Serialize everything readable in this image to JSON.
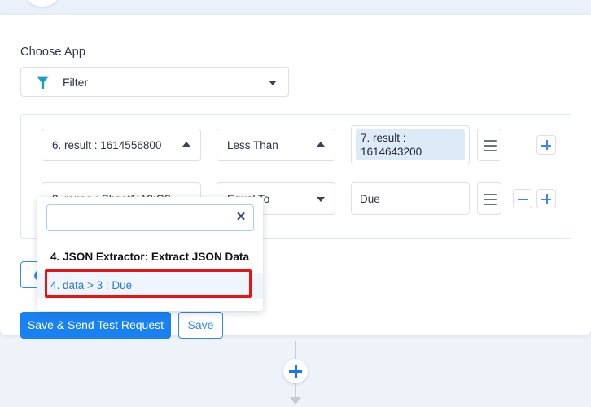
{
  "choose_app": {
    "label": "Choose App",
    "selected": "Filter",
    "icon": "funnel-icon",
    "caret": "chevron-down-icon"
  },
  "filter_rows": [
    {
      "field": "6. result : 1614556800",
      "field_caret": "chevron-up-icon",
      "operator": "Less Than",
      "operator_caret": "chevron-up-icon",
      "value": "7. result : 1614643200",
      "value_is_chip": true,
      "menu_icon": "hamburger-icon",
      "add_label": "+",
      "has_remove": false
    },
    {
      "field": "2. range : Sheet1!A2:G3",
      "field_caret": "chevron-down-icon",
      "operator": "Equal To",
      "operator_caret": "chevron-down-icon",
      "value": "Due",
      "value_is_chip": false,
      "menu_icon": "hamburger-icon",
      "add_label": "+",
      "remove_label": "−",
      "has_remove": true
    }
  ],
  "dropdown": {
    "search_value": "",
    "search_placeholder": "",
    "clear_icon": "✕",
    "group_label": "4. JSON Extractor: Extract JSON Data",
    "items": [
      {
        "label": "4. data > 3 : Due",
        "highlighted": true
      }
    ],
    "highlight_color": "#e81414"
  },
  "actions": {
    "reload_icon": "refresh-icon",
    "primary_label": "Save & Send Test Request",
    "secondary_label": "Save"
  },
  "flow": {
    "add_step_icon": "plus-icon"
  },
  "colors": {
    "accent": "#1a82f0",
    "link": "#2f7ad1",
    "chip_bg": "#ddeaf8",
    "page_bg": "#eef3fa",
    "highlight_border": "#e81414"
  }
}
